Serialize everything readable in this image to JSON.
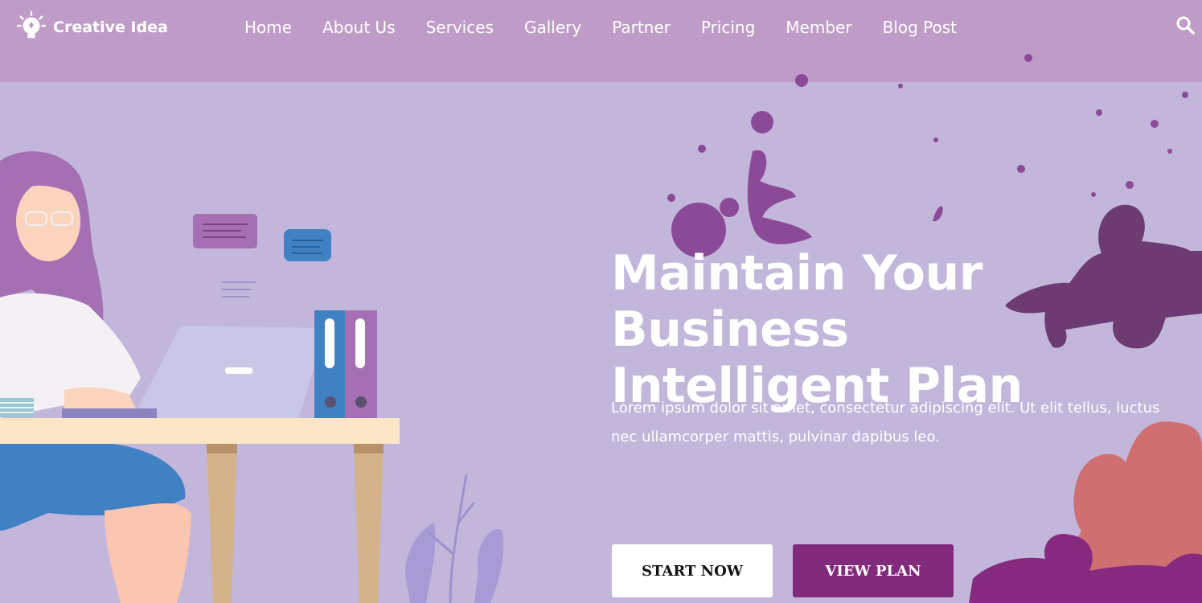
{
  "brand": {
    "name": "Creative Idea"
  },
  "nav": {
    "items": [
      {
        "label": "Home"
      },
      {
        "label": "About Us"
      },
      {
        "label": "Services"
      },
      {
        "label": "Gallery"
      },
      {
        "label": "Partner"
      },
      {
        "label": "Pricing"
      },
      {
        "label": "Member"
      },
      {
        "label": "Blog Post"
      }
    ]
  },
  "hero": {
    "title_line1": "Maintain Your Business",
    "title_line2": "Intelligent Plan",
    "description": "Lorem ipsum dolor sit amet, consectetur adipiscing elit. Ut elit tellus, luctus nec ullamcorper mattis, pulvinar dapibus leo.",
    "start_button": "START NOW",
    "plan_button": "VIEW PLAN"
  },
  "colors": {
    "header_bg": "#bf9cc8",
    "hero_bg": "#c2b6db",
    "accent": "#822a7c"
  },
  "icons": {
    "logo": "lightbulb-icon",
    "search": "search-icon"
  }
}
